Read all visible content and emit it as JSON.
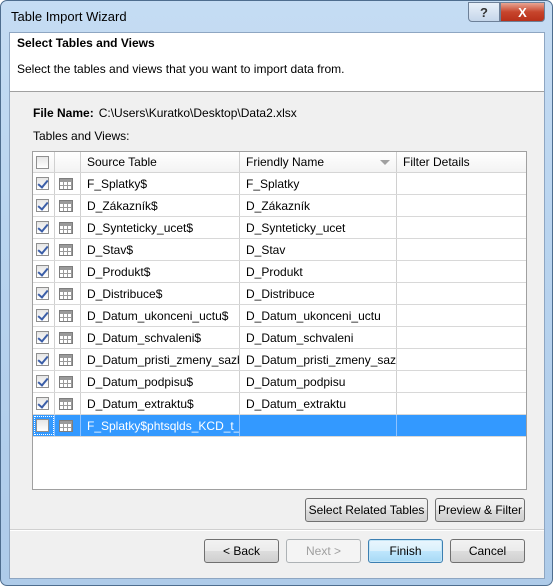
{
  "window": {
    "title": "Table Import Wizard",
    "help_label": "?",
    "close_label": "X"
  },
  "header": {
    "title": "Select Tables and Views",
    "description": "Select the tables and views that you want to import data from."
  },
  "file": {
    "label": "File Name:",
    "path": "C:\\Users\\Kuratko\\Desktop\\Data2.xlsx"
  },
  "grid": {
    "label": "Tables and Views:",
    "columns": [
      "Source Table",
      "Friendly Name",
      "Filter Details"
    ],
    "rows": [
      {
        "checked": true,
        "source": "F_Splatky$",
        "friendly": "F_Splatky",
        "filter": ""
      },
      {
        "checked": true,
        "source": "D_Zákazník$",
        "friendly": "D_Zákazník",
        "filter": ""
      },
      {
        "checked": true,
        "source": "D_Synteticky_ucet$",
        "friendly": "D_Synteticky_ucet",
        "filter": ""
      },
      {
        "checked": true,
        "source": "D_Stav$",
        "friendly": "D_Stav",
        "filter": ""
      },
      {
        "checked": true,
        "source": "D_Produkt$",
        "friendly": "D_Produkt",
        "filter": ""
      },
      {
        "checked": true,
        "source": "D_Distribuce$",
        "friendly": "D_Distribuce",
        "filter": ""
      },
      {
        "checked": true,
        "source": "D_Datum_ukonceni_uctu$",
        "friendly": "D_Datum_ukonceni_uctu",
        "filter": ""
      },
      {
        "checked": true,
        "source": "D_Datum_schvaleni$",
        "friendly": "D_Datum_schvaleni",
        "filter": ""
      },
      {
        "checked": true,
        "source": "D_Datum_pristi_zmeny_sazby$",
        "friendly": "D_Datum_pristi_zmeny_sazby",
        "filter": ""
      },
      {
        "checked": true,
        "source": "D_Datum_podpisu$",
        "friendly": "D_Datum_podpisu",
        "filter": ""
      },
      {
        "checked": true,
        "source": "D_Datum_extraktu$",
        "friendly": "D_Datum_extraktu",
        "filter": ""
      },
      {
        "checked": false,
        "selected": true,
        "source": "F_Splatky$phtsqlds_KCD_t_...",
        "friendly": "",
        "filter": ""
      }
    ]
  },
  "buttons": {
    "select_related": "Select Related Tables",
    "preview_filter": "Preview & Filter",
    "back": "< Back",
    "next": "Next >",
    "finish": "Finish",
    "cancel": "Cancel"
  },
  "colors": {
    "selection": "#3399ff"
  }
}
